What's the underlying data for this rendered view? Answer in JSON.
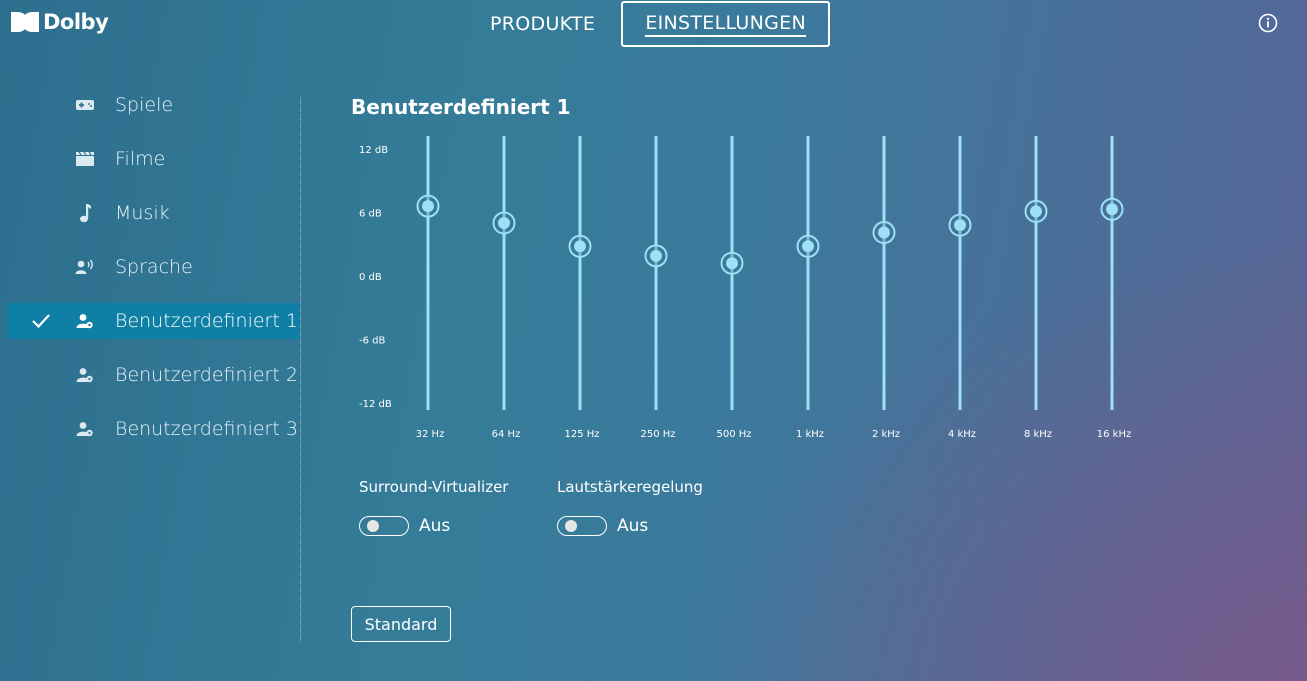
{
  "header": {
    "logo_text": "Dolby",
    "tabs": [
      {
        "label": "PRODUKTE",
        "active": false
      },
      {
        "label": "EINSTELLUNGEN",
        "active": true
      }
    ],
    "info_icon": "info-icon"
  },
  "sidebar": {
    "items": [
      {
        "label": "Spiele",
        "icon": "gamepad-icon",
        "active": false
      },
      {
        "label": "Filme",
        "icon": "clapperboard-icon",
        "active": false
      },
      {
        "label": "Musik",
        "icon": "music-note-icon",
        "active": false
      },
      {
        "label": "Sprache",
        "icon": "voice-icon",
        "active": false
      },
      {
        "label": "Benutzerdefiniert 1",
        "icon": "user-settings-icon",
        "active": true
      },
      {
        "label": "Benutzerdefiniert 2",
        "icon": "user-settings-icon",
        "active": false
      },
      {
        "label": "Benutzerdefiniert 3",
        "icon": "user-settings-icon",
        "active": false
      }
    ]
  },
  "main": {
    "preset_title": "Benutzerdefiniert 1",
    "equalizer": {
      "db_labels": [
        "12 dB",
        "6 dB",
        "0 dB",
        "-6 dB",
        "-12 dB"
      ],
      "db_range": [
        -12,
        12
      ],
      "bands": [
        {
          "freq": "32 Hz",
          "gain_db": 6.7
        },
        {
          "freq": "64 Hz",
          "gain_db": 5.1
        },
        {
          "freq": "125 Hz",
          "gain_db": 2.9
        },
        {
          "freq": "250 Hz",
          "gain_db": 2.0
        },
        {
          "freq": "500 Hz",
          "gain_db": 1.3
        },
        {
          "freq": "1 kHz",
          "gain_db": 2.9
        },
        {
          "freq": "2 kHz",
          "gain_db": 4.2
        },
        {
          "freq": "4 kHz",
          "gain_db": 4.9
        },
        {
          "freq": "8 kHz",
          "gain_db": 6.2
        },
        {
          "freq": "16 kHz",
          "gain_db": 6.4
        }
      ],
      "slider_color": "#9ee0f5"
    },
    "surround": {
      "label": "Surround-Virtualizer",
      "state": "Aus",
      "on": false
    },
    "volume": {
      "label": "Lautstärkeregelung",
      "state": "Aus",
      "on": false
    },
    "standard_button": "Standard"
  }
}
